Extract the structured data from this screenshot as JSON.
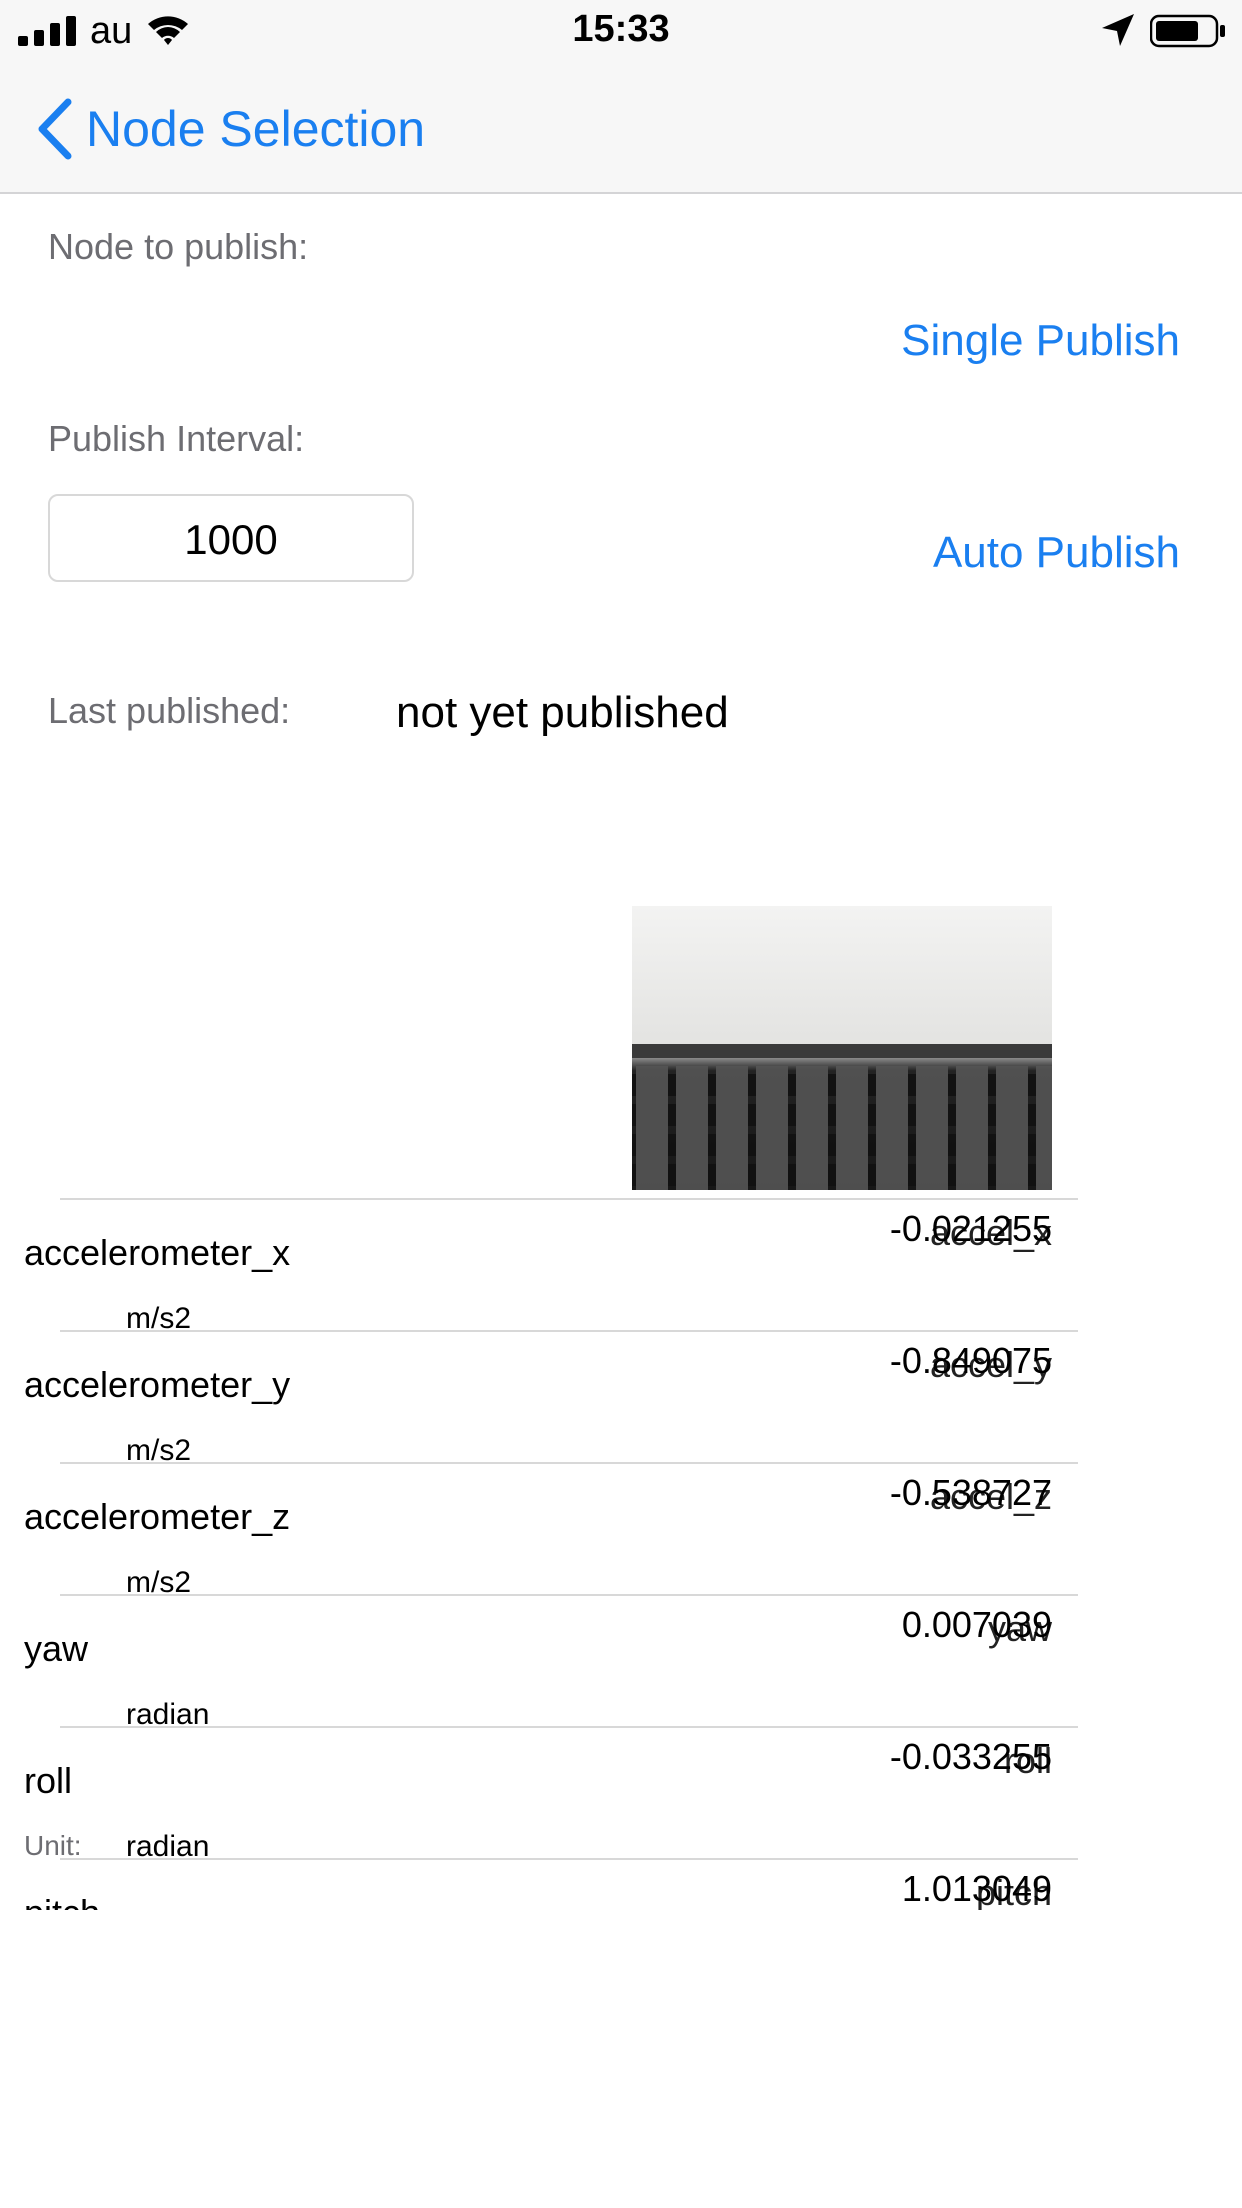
{
  "status_bar": {
    "carrier": "au",
    "time": "15:33"
  },
  "nav": {
    "back_label": "Node Selection"
  },
  "form": {
    "node_to_publish_label": "Node to publish:",
    "single_publish_label": "Single Publish",
    "publish_interval_label": "Publish Interval:",
    "publish_interval_value": "1000",
    "auto_publish_label": "Auto Publish",
    "last_published_label": "Last published:",
    "last_published_value": "not yet published"
  },
  "sensors": [
    {
      "name": "accelerometer_x",
      "unit": "m/s2",
      "value": "-0.021255",
      "ghost": "accel_x"
    },
    {
      "name": "accelerometer_y",
      "unit": "m/s2",
      "value": "-0.849075",
      "ghost": "accel_y"
    },
    {
      "name": "accelerometer_z",
      "unit": "m/s2",
      "value": "-0.538727",
      "ghost": "accel_z"
    },
    {
      "name": "yaw",
      "unit": "radian",
      "value": "0.007039",
      "ghost": "yaw"
    },
    {
      "name": "roll",
      "unit": "radian",
      "unit_label": "Unit:",
      "value": "-0.033255",
      "ghost": "roll"
    },
    {
      "name": "pitch",
      "unit": "",
      "value": "1.013049",
      "ghost": "pitch"
    }
  ],
  "colors": {
    "accent": "#1a7ff0",
    "label_gray": "#6d6d72",
    "separator": "#d8d8d8"
  }
}
